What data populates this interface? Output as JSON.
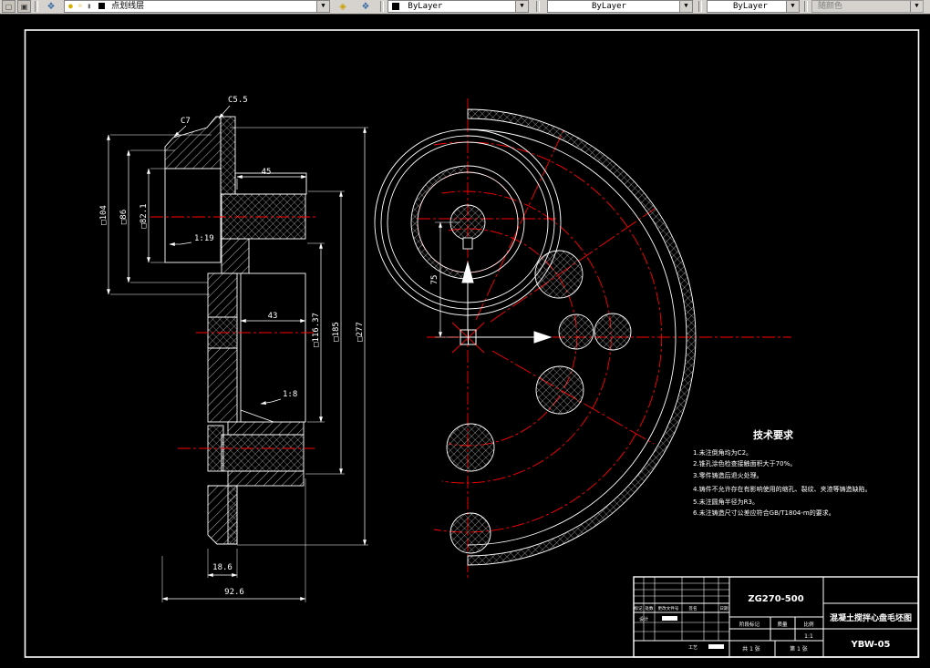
{
  "toolbar": {
    "layer_combo": "点划线层",
    "color_combo": "ByLayer",
    "linetype_combo": "ByLayer",
    "lineweight_combo": "ByLayer",
    "plotstyle_combo": "随颜色",
    "dropdown_glyph": "▼"
  },
  "drawing": {
    "dims": {
      "c55": "C5.5",
      "c7": "C7",
      "w45": "45",
      "taper19": "1:19",
      "w43": "43",
      "taper8": "1:8",
      "w186": "18.6",
      "w926": "92.6",
      "d104": "□104",
      "d86": "□86",
      "d82": "□82.1",
      "d116": "□116.37",
      "d185": "□185",
      "d277": "□277",
      "r75": "75"
    },
    "tech": {
      "title": "技术要求",
      "lines": [
        "1.未注倒角均为C2。",
        "2.锥孔涂色检查接触面积大于70%。",
        "3.零件铸造后退火处理。",
        "4.铸件不允许存在有影响使用的缩孔、裂纹、夹渣等铸造缺陷。",
        "5.未注圆角半径为R3。",
        "6.未注铸造尺寸公差应符合GB/T1804-m的要求。"
      ]
    },
    "titleblock": {
      "material": "ZG270-500",
      "part_title": "混凝土搅拌心盘毛坯图",
      "drawing_no": "YBW-05",
      "h_stage": "阶段标记",
      "h_mass": "质量",
      "h_scale": "比例",
      "scale_value": "1:1",
      "sheets": "共 1 张",
      "sheet_no": "第 1 张",
      "rev_headers": [
        "标记",
        "处数",
        "更改文件号",
        "签名",
        "日期"
      ],
      "row_design": "设计",
      "row_process": "工艺"
    }
  },
  "colors": {
    "centerline_red": "#ff0000",
    "drawing_line": "#ffffff",
    "toolbar_bg": "#d6d3ce"
  }
}
